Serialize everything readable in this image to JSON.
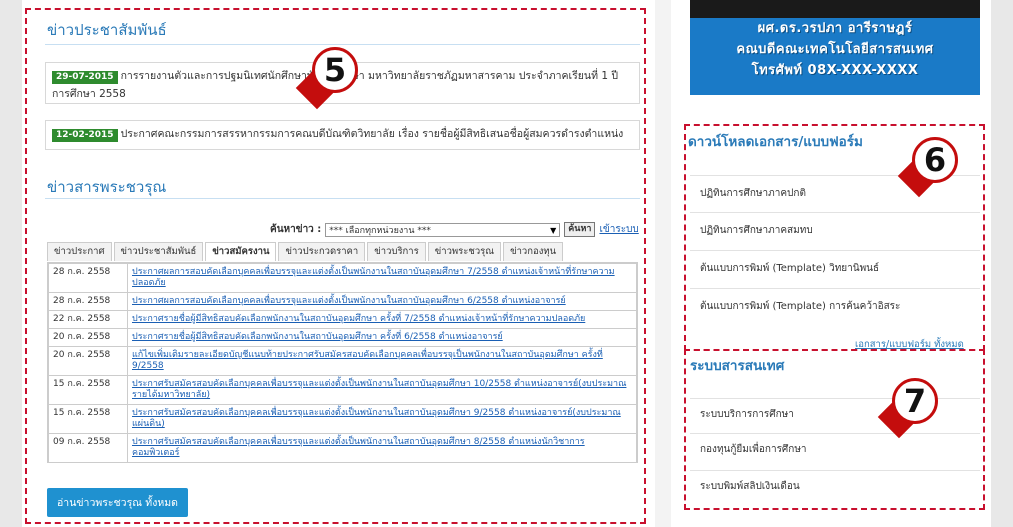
{
  "left": {
    "pr_news_title": "ข่าวประชาสัมพันธ์",
    "pr_news": [
      {
        "date": "29-07-2015",
        "text": "การรายงานตัวและการปฐมนิเทศนักศึกษาบัณฑิตศึกษา มหาวิทยาลัยราชภัฏมหาสารคาม ประจำภาคเรียนที่ 1 ปีการศึกษา 2558"
      },
      {
        "date": "12-02-2015",
        "text": "ประกาศคณะกรรมการสรรหากรรมการคณบดีบัณฑิตวิทยาลัย เรื่อง รายชื่อผู้มีสิทธิเสนอชื่อผู้สมควรดำรงตำแหน่ง"
      }
    ],
    "jobs_title": "ข่าวสารพระชวรุณ",
    "search": {
      "label": "ค้นหาข่าว :",
      "selected": "*** เลือกทุกหน่วยงาน ***",
      "button": "ค้นหา",
      "link": "เข้าระบบ"
    },
    "tabs": [
      {
        "label": "ข่าวประกาศ",
        "active": false
      },
      {
        "label": "ข่าวประชาสัมพันธ์",
        "active": false
      },
      {
        "label": "ข่าวสมัครงาน",
        "active": true
      },
      {
        "label": "ข่าวประกวดราคา",
        "active": false
      },
      {
        "label": "ข่าวบริการ",
        "active": false
      },
      {
        "label": "ข่าวพระชวรุณ",
        "active": false
      },
      {
        "label": "ข่าวกองทุน",
        "active": false
      }
    ],
    "rows": [
      {
        "date": "28 ก.ค. 2558",
        "title": "ประกาศผลการสอบคัดเลือกบุคคลเพื่อบรรจุและแต่งตั้งเป็นพนักงานในสถาบันอุดมศึกษา 7/2558 ตำแหน่งเจ้าหน้าที่รักษาความปลอดภัย"
      },
      {
        "date": "28 ก.ค. 2558",
        "title": "ประกาศผลการสอบคัดเลือกบุคคลเพื่อบรรจุและแต่งตั้งเป็นพนักงานในสถาบันอุดมศึกษา 6/2558 ตำแหน่งอาจารย์"
      },
      {
        "date": "22 ก.ค. 2558",
        "title": "ประกาศรายชื่อผู้มีสิทธิสอบคัดเลือกพนักงานในสถาบันอุดมศึกษา ครั้งที่ 7/2558 ตำแหน่งเจ้าหน้าที่รักษาความปลอดภัย"
      },
      {
        "date": "20 ก.ค. 2558",
        "title": "ประกาศรายชื่อผู้มีสิทธิสอบคัดเลือกพนักงานในสถาบันอุดมศึกษา ครั้งที่ 6/2558 ตำแหน่งอาจารย์"
      },
      {
        "date": "20 ก.ค. 2558",
        "title": "แก้ไขเพิ่มเติมรายละเอียดบัญชีแนบท้ายประกาศรับสมัครสอบคัดเลือกบุคคลเพื่อบรรจุเป็นพนักงานในสถาบันอุดมศึกษา ครั้งที่ 9/2558"
      },
      {
        "date": "15 ก.ค. 2558",
        "title": "ประกาศรับสมัครสอบคัดเลือกบุคคลเพื่อบรรจุและแต่งตั้งเป็นพนักงานในสถาบันอุดมศึกษา 10/2558 ตำแหน่งอาจารย์(งบประมาณรายได้มหาวิทยาลัย)"
      },
      {
        "date": "15 ก.ค. 2558",
        "title": "ประกาศรับสมัครสอบคัดเลือกบุคคลเพื่อบรรจุและแต่งตั้งเป็นพนักงานในสถาบันอุดมศึกษา 9/2558 ตำแหน่งอาจารย์(งบประมาณแผ่นดิน)"
      },
      {
        "date": "09 ก.ค. 2558",
        "title": "ประกาศรับสมัครสอบคัดเลือกบุคคลเพื่อบรรจุและแต่งตั้งเป็นพนักงานในสถาบันอุดมศึกษา 8/2558 ตำแหน่งนักวิชาการคอมพิวเตอร์"
      }
    ],
    "read_all": "อ่านข่าวพระชวรุณ ทั้งหมด"
  },
  "right": {
    "banner": [
      "ผศ.ดร.วรปภา อารีราษฎร์",
      "คณบดีคณะเทคโนโลยีสารสนเทศ",
      "โทรศัพท์ 08X-XXX-XXXX"
    ],
    "downloads_title": "ดาวน์โหลดเอกสาร/แบบฟอร์ม",
    "downloads": [
      "ปฏิทินการศึกษาภาคปกติ",
      "ปฏิทินการศึกษาภาคสมทบ",
      "ต้นแบบการพิมพ์ (Template) วิทยานิพนธ์",
      "ต้นแบบการพิมพ์ (Template) การค้นคว้าอิสระ"
    ],
    "downloads_all": "เอกสาร/แบบฟอร์ม ทั้งหมด",
    "systems_title": "ระบบสารสนเทศ",
    "systems": [
      "ระบบบริการการศึกษา",
      "กองทุนกู้ยืมเพื่อการศึกษา",
      "ระบบพิมพ์สลิปเงินเดือน"
    ]
  },
  "markers": [
    "5",
    "6",
    "7"
  ],
  "colors": {
    "accent": "#2a7ab8",
    "marker": "#c40d0d",
    "badge": "#2e8b2e",
    "button": "#1f91d0"
  }
}
